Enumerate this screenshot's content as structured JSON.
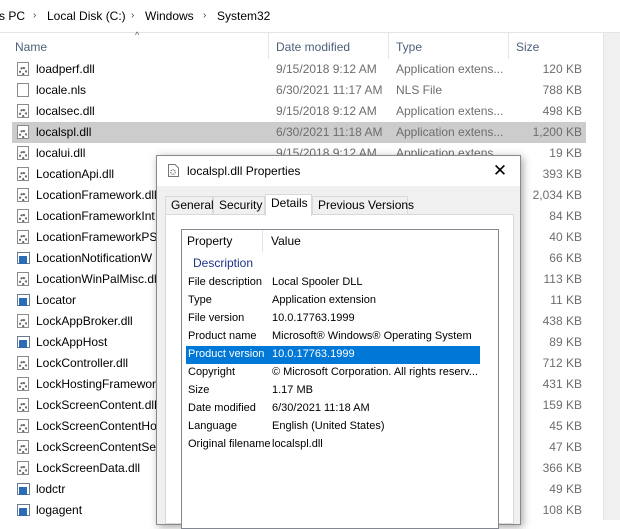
{
  "breadcrumb": {
    "items": [
      "s PC",
      "Local Disk (C:)",
      "Windows",
      "System32"
    ],
    "separator": "›"
  },
  "columns": {
    "name": "Name",
    "date": "Date modified",
    "type": "Type",
    "size": "Size"
  },
  "files": [
    {
      "name": "loadperf.dll",
      "date": "9/15/2018 9:12 AM",
      "type": "Application extens...",
      "size": "120 KB",
      "icon": "dll-file-icon"
    },
    {
      "name": "locale.nls",
      "date": "6/30/2021 11:17 AM",
      "type": "NLS File",
      "size": "788 KB",
      "icon": "document-file-icon"
    },
    {
      "name": "localsec.dll",
      "date": "9/15/2018 9:12 AM",
      "type": "Application extens...",
      "size": "498 KB",
      "icon": "dll-file-icon"
    },
    {
      "name": "localspl.dll",
      "date": "6/30/2021 11:18 AM",
      "type": "Application extens...",
      "size": "1,200 KB",
      "icon": "dll-file-icon"
    },
    {
      "name": "localui.dll",
      "date": "9/15/2018 9:12 AM",
      "type": "Application extens...",
      "size": "19 KB",
      "icon": "dll-file-icon"
    },
    {
      "name": "LocationApi.dll",
      "date": "",
      "type": "",
      "size": "393 KB",
      "icon": "dll-file-icon"
    },
    {
      "name": "LocationFramework.dll",
      "date": "",
      "type": "",
      "size": "2,034 KB",
      "icon": "dll-file-icon"
    },
    {
      "name": "LocationFrameworkInt",
      "date": "",
      "type": "",
      "size": "84 KB",
      "icon": "dll-file-icon"
    },
    {
      "name": "LocationFrameworkPS.",
      "date": "",
      "type": "",
      "size": "40 KB",
      "icon": "dll-file-icon"
    },
    {
      "name": "LocationNotificationW",
      "date": "",
      "type": "",
      "size": "66 KB",
      "icon": "application-icon"
    },
    {
      "name": "LocationWinPalMisc.dl",
      "date": "",
      "type": "",
      "size": "113 KB",
      "icon": "dll-file-icon"
    },
    {
      "name": "Locator",
      "date": "",
      "type": "",
      "size": "11 KB",
      "icon": "application-icon"
    },
    {
      "name": "LockAppBroker.dll",
      "date": "",
      "type": "",
      "size": "438 KB",
      "icon": "dll-file-icon"
    },
    {
      "name": "LockAppHost",
      "date": "",
      "type": "",
      "size": "89 KB",
      "icon": "application-icon"
    },
    {
      "name": "LockController.dll",
      "date": "",
      "type": "",
      "size": "712 KB",
      "icon": "dll-file-icon"
    },
    {
      "name": "LockHostingFramewor",
      "date": "",
      "type": "",
      "size": "431 KB",
      "icon": "dll-file-icon"
    },
    {
      "name": "LockScreenContent.dll",
      "date": "",
      "type": "",
      "size": "159 KB",
      "icon": "dll-file-icon"
    },
    {
      "name": "LockScreenContentHo",
      "date": "",
      "type": "",
      "size": "45 KB",
      "icon": "dll-file-icon"
    },
    {
      "name": "LockScreenContentSer",
      "date": "",
      "type": "",
      "size": "47 KB",
      "icon": "dll-file-icon"
    },
    {
      "name": "LockScreenData.dll",
      "date": "",
      "type": "",
      "size": "366 KB",
      "icon": "dll-file-icon"
    },
    {
      "name": "lodctr",
      "date": "",
      "type": "",
      "size": "49 KB",
      "icon": "application-icon"
    },
    {
      "name": "logagent",
      "date": "",
      "type": "",
      "size": "108 KB",
      "icon": "application-icon"
    }
  ],
  "selected_file_index": 3,
  "dialog": {
    "title": "localspl.dll Properties",
    "close_glyph": "✕",
    "tabs": [
      "General",
      "Security",
      "Details",
      "Previous Versions"
    ],
    "active_tab": "Details",
    "list_header": {
      "property": "Property",
      "value": "Value"
    },
    "group": "Description",
    "rows": [
      {
        "name": "File description",
        "value": "Local Spooler DLL"
      },
      {
        "name": "Type",
        "value": "Application extension"
      },
      {
        "name": "File version",
        "value": "10.0.17763.1999"
      },
      {
        "name": "Product name",
        "value": "Microsoft® Windows® Operating System"
      },
      {
        "name": "Product version",
        "value": "10.0.17763.1999"
      },
      {
        "name": "Copyright",
        "value": "© Microsoft Corporation. All rights reserv..."
      },
      {
        "name": "Size",
        "value": "1.17 MB"
      },
      {
        "name": "Date modified",
        "value": "6/30/2021 11:18 AM"
      },
      {
        "name": "Language",
        "value": "English (United States)"
      },
      {
        "name": "Original filename",
        "value": "localspl.dll"
      }
    ],
    "selected_row_index": 4
  },
  "colors": {
    "selection_blue": "#0078d7",
    "row_selected_gray": "#cccccc",
    "header_text": "#4c607a",
    "group_text": "#1e3287"
  }
}
